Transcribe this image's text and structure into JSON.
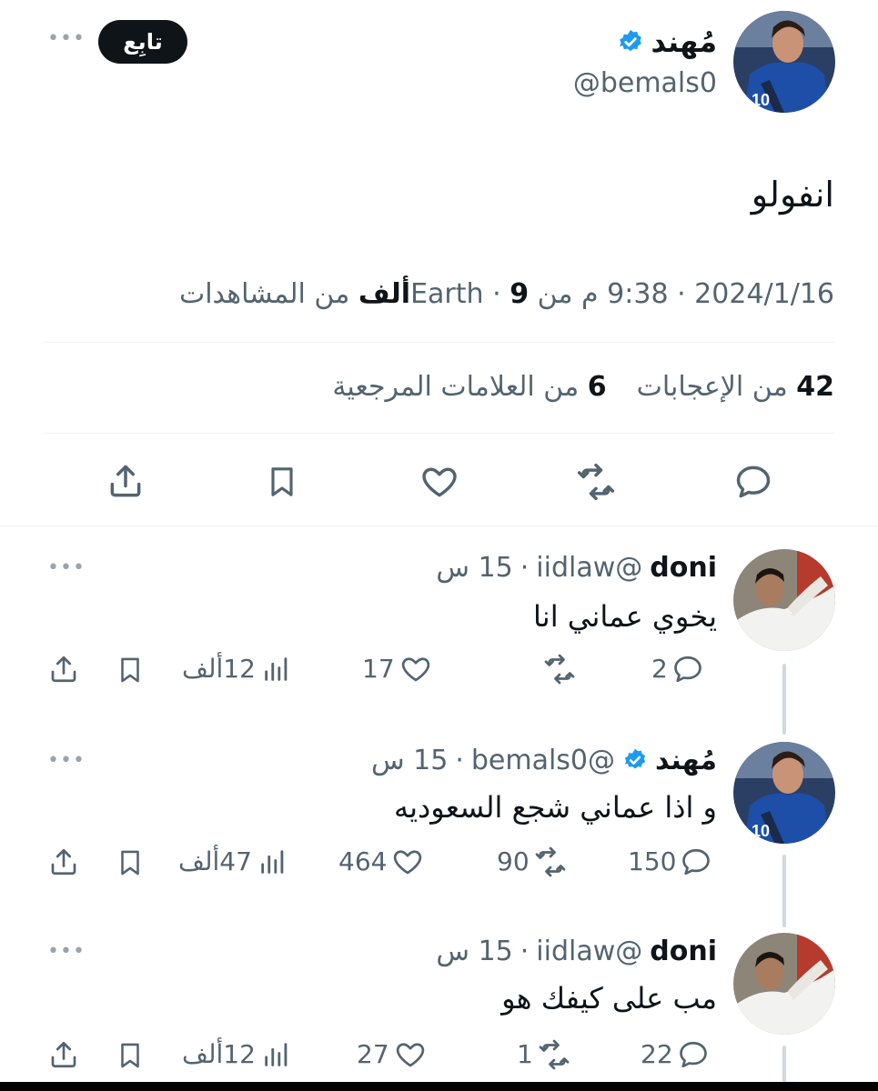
{
  "main_tweet": {
    "author": {
      "name": "مُهند",
      "handle": "@bemals0",
      "verified": true
    },
    "follow_label": "تابِع",
    "more": "•••",
    "text": "انفولو",
    "meta": {
      "date": "2024/1/16",
      "sep1": "·",
      "time": "9:38 م من Earth",
      "sep2": "·",
      "views_count": "9ألف",
      "views_label": "من المشاهدات"
    },
    "stats": {
      "likes_count": "42",
      "likes_label": "من الإعجابات",
      "bookmarks_count": "6",
      "bookmarks_label": "من العلامات المرجعية"
    }
  },
  "replies": [
    {
      "author": "doni",
      "handle": "@iidlaw",
      "sep": "·",
      "time": "15 س",
      "verified": false,
      "text": "يخوي عماني انا",
      "replies": "2",
      "retweets": "",
      "likes": "17",
      "views": "12ألف"
    },
    {
      "author": "مُهند",
      "handle": "@bemals0",
      "sep": "·",
      "time": "15 س",
      "verified": true,
      "text": "و اذا عماني شجع السعوديه",
      "replies": "150",
      "retweets": "90",
      "likes": "464",
      "views": "47ألف"
    },
    {
      "author": "doni",
      "handle": "@iidlaw",
      "sep": "·",
      "time": "15 س",
      "verified": false,
      "text": "مب على كيفك هو",
      "replies": "22",
      "retweets": "1",
      "likes": "27",
      "views": "12ألف"
    }
  ],
  "colors": {
    "verified": "#1d9bf0",
    "text": "#0f1419",
    "muted": "#536471",
    "divider": "#eff3f4"
  }
}
